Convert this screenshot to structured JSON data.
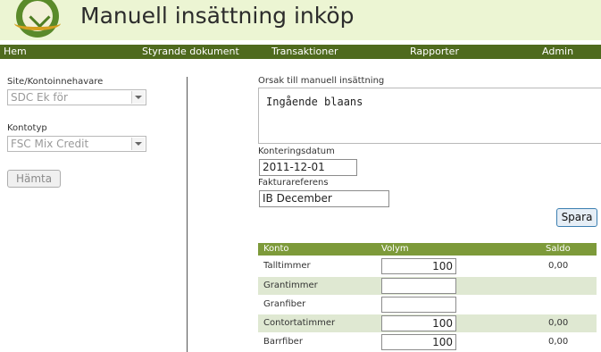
{
  "header": {
    "title": "Manuell insättning inköp"
  },
  "nav": [
    "Hem",
    "Styrande dokument",
    "Transaktioner",
    "Rapporter",
    "Admin"
  ],
  "left": {
    "site_label": "Site/Kontoinnehavare",
    "site_value": "SDC Ek för",
    "type_label": "Kontotyp",
    "type_value": "FSC Mix Credit",
    "fetch_button": "Hämta"
  },
  "form": {
    "reason_label": "Orsak till manuell insättning",
    "reason_value": "Ingående blaans",
    "date_label": "Konteringsdatum",
    "date_value": "2011-12-01",
    "ref_label": "Fakturareferens",
    "ref_value": "IB December",
    "save_button": "Spara"
  },
  "table": {
    "headers": {
      "konto": "Konto",
      "volym": "Volym",
      "saldo": "Saldo"
    },
    "rows": [
      {
        "konto": "Talltimmer",
        "volym": "100",
        "saldo": "0,00"
      },
      {
        "konto": "Grantimmer",
        "volym": "",
        "saldo": ""
      },
      {
        "konto": "Granfiber",
        "volym": "",
        "saldo": ""
      },
      {
        "konto": "Contortatimmer",
        "volym": "100",
        "saldo": "0,00"
      },
      {
        "konto": "Barrfiber",
        "volym": "100",
        "saldo": "0,00"
      }
    ]
  }
}
